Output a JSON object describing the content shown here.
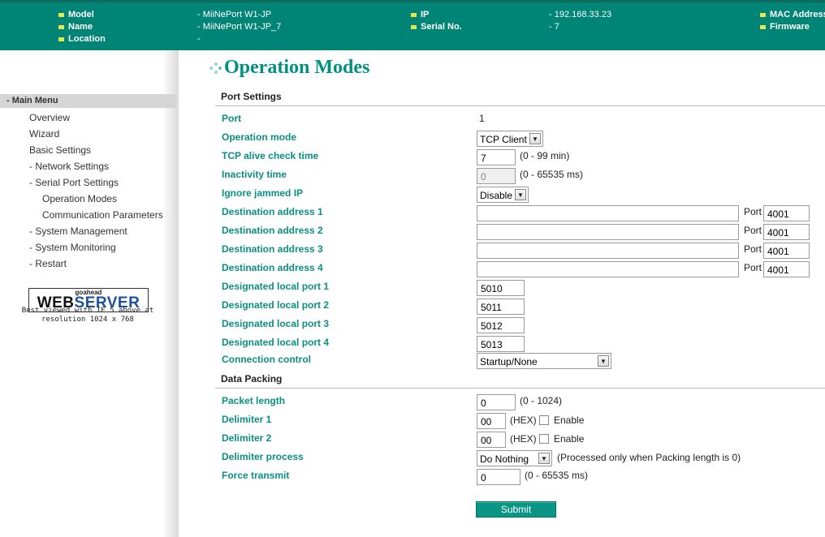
{
  "header": {
    "model_label": "Model",
    "model_value": "- MiiNePort W1-JP",
    "name_label": "Name",
    "name_value": "- MiiNePort W1-JP_7",
    "location_label": "Location",
    "location_value": "-",
    "ip_label": "IP",
    "ip_value": "- 192.168.33.23",
    "serial_label": "Serial No.",
    "serial_value": "- 7",
    "mac_label": "MAC Address",
    "firmware_label": "Firmware"
  },
  "sidebar": {
    "menu_header": "- Main Menu",
    "items": [
      "Overview",
      "Wizard",
      "Basic Settings",
      "- Network Settings",
      "- Serial Port Settings",
      "Operation Modes",
      "Communication Parameters",
      "- System Management",
      "- System Monitoring",
      "- Restart"
    ],
    "logo_top": "goahead",
    "logo_web": "WEB",
    "logo_server": "SERVER",
    "best_viewed": "Best viewed with IE 5 above at resolution 1024 x 768"
  },
  "page_title": "Operation Modes",
  "port_settings": {
    "section_label": "Port Settings",
    "port_label": "Port",
    "port_value": "1",
    "operation_mode_label": "Operation mode",
    "operation_mode_value": "TCP Client",
    "tcp_alive_label": "TCP alive check time",
    "tcp_alive_value": "7",
    "tcp_alive_hint": "(0 - 99 min)",
    "inactivity_label": "Inactivity time",
    "inactivity_value": "0",
    "inactivity_hint": "(0 - 65535 ms)",
    "ignore_jammed_label": "Ignore jammed IP",
    "ignore_jammed_value": "Disable",
    "destinations": [
      {
        "label": "Destination address 1",
        "value": "",
        "port_label": "Port",
        "port": "4001"
      },
      {
        "label": "Destination address 2",
        "value": "",
        "port_label": "Port",
        "port": "4001"
      },
      {
        "label": "Destination address 3",
        "value": "",
        "port_label": "Port",
        "port": "4001"
      },
      {
        "label": "Destination address 4",
        "value": "",
        "port_label": "Port",
        "port": "4001"
      }
    ],
    "local_ports": [
      {
        "label": "Designated local port 1",
        "value": "5010"
      },
      {
        "label": "Designated local port 2",
        "value": "5011"
      },
      {
        "label": "Designated local port 3",
        "value": "5012"
      },
      {
        "label": "Designated local port 4",
        "value": "5013"
      }
    ],
    "connection_control_label": "Connection control",
    "connection_control_value": "Startup/None"
  },
  "data_packing": {
    "section_label": "Data Packing",
    "packet_length_label": "Packet length",
    "packet_length_value": "0",
    "packet_length_hint": "(0 - 1024)",
    "delimiter1_label": "Delimiter 1",
    "delimiter1_value": "00",
    "delimiter1_hex": "(HEX)",
    "delimiter1_enable": "Enable",
    "delimiter2_label": "Delimiter 2",
    "delimiter2_value": "00",
    "delimiter2_hex": "(HEX)",
    "delimiter2_enable": "Enable",
    "delimiter_process_label": "Delimiter process",
    "delimiter_process_value": "Do Nothing",
    "delimiter_process_hint": "(Processed only when Packing length is 0)",
    "force_transmit_label": "Force transmit",
    "force_transmit_value": "0",
    "force_transmit_hint": "(0 - 65535 ms)"
  },
  "submit_label": "Submit"
}
